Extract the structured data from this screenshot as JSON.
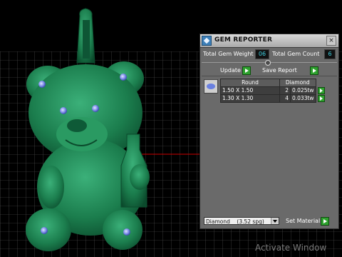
{
  "panel": {
    "title": "GEM REPORTER",
    "close_glyph": "×",
    "total_weight_label": "Total Gem Weight",
    "total_weight_value": "06",
    "total_count_label": "Total Gem Count",
    "total_count_value": "6",
    "update_label": "Update",
    "save_report_label": "Save Report",
    "table": {
      "headers": [
        "Round",
        "Diamond"
      ],
      "rows": [
        {
          "size": "1.50 X 1.50",
          "count": "2",
          "weight": "0.025tw"
        },
        {
          "size": "1.30 X 1.30",
          "count": "4",
          "weight": "0.033tw"
        }
      ]
    },
    "material_select": "Diamond    (3.52 spg)",
    "set_material_label": "Set Material"
  },
  "watermark": "Activate Window",
  "colors": {
    "model": "#1f8a55",
    "gem": "#7f8dea",
    "grid": "#d8d8d8",
    "axis_red": "#cc0000",
    "go_button": "#2ea12e",
    "field_text": "#3fd0e0"
  },
  "icons": [
    "gem-reporter-icon",
    "close-icon",
    "go-arrow-icon",
    "dropdown-arrow-icon",
    "gem-thumbnail-icon"
  ]
}
